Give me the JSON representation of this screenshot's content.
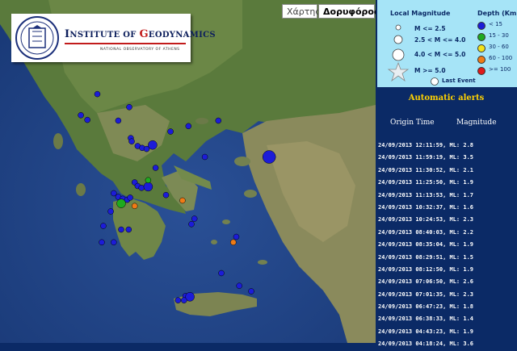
{
  "map": {
    "buttons": {
      "map_label": "Χάρτης",
      "satellite_label": "Δορυφόρος"
    },
    "logo": {
      "name_prefix": "I",
      "name_part1": "NSTITUTE OF ",
      "name_accent": "G",
      "name_part2": "EODYNAMICS",
      "subtitle": "NATIONAL OBSERVATORY OF ATHENS"
    },
    "events": [
      {
        "lon": 21.85,
        "lat": 40.63,
        "size": "small",
        "depth": "<15"
      },
      {
        "lon": 21.3,
        "lat": 40.05,
        "size": "small",
        "depth": "<15"
      },
      {
        "lon": 21.52,
        "lat": 39.92,
        "size": "small",
        "depth": "<15"
      },
      {
        "lon": 22.92,
        "lat": 40.27,
        "size": "small",
        "depth": "<15"
      },
      {
        "lon": 22.55,
        "lat": 39.9,
        "size": "small",
        "depth": "<15"
      },
      {
        "lon": 22.97,
        "lat": 39.42,
        "size": "small",
        "depth": "<15"
      },
      {
        "lon": 23.2,
        "lat": 39.2,
        "size": "small",
        "depth": "<15"
      },
      {
        "lon": 23.35,
        "lat": 39.15,
        "size": "small",
        "depth": "<15"
      },
      {
        "lon": 23.5,
        "lat": 39.12,
        "size": "small",
        "depth": "<15"
      },
      {
        "lon": 23.7,
        "lat": 39.23,
        "size": "medium",
        "depth": "<15"
      },
      {
        "lon": 23.0,
        "lat": 39.33,
        "size": "small",
        "depth": "<15"
      },
      {
        "lon": 24.3,
        "lat": 39.6,
        "size": "small",
        "depth": "<15"
      },
      {
        "lon": 24.9,
        "lat": 39.75,
        "size": "small",
        "depth": "<15"
      },
      {
        "lon": 25.9,
        "lat": 39.9,
        "size": "small",
        "depth": "<15"
      },
      {
        "lon": 27.6,
        "lat": 38.9,
        "size": "large",
        "depth": "<15"
      },
      {
        "lon": 25.45,
        "lat": 38.9,
        "size": "small",
        "depth": "<15"
      },
      {
        "lon": 23.1,
        "lat": 38.2,
        "size": "small",
        "depth": "<15"
      },
      {
        "lon": 23.2,
        "lat": 38.1,
        "size": "small",
        "depth": "<15"
      },
      {
        "lon": 23.33,
        "lat": 38.05,
        "size": "small",
        "depth": "<15"
      },
      {
        "lon": 23.55,
        "lat": 38.08,
        "size": "medium",
        "depth": "<15"
      },
      {
        "lon": 23.55,
        "lat": 38.26,
        "size": "small",
        "depth": "15-30"
      },
      {
        "lon": 22.4,
        "lat": 37.9,
        "size": "small",
        "depth": "<15"
      },
      {
        "lon": 22.55,
        "lat": 37.8,
        "size": "small",
        "depth": "<15"
      },
      {
        "lon": 22.7,
        "lat": 37.75,
        "size": "small",
        "depth": "<15"
      },
      {
        "lon": 22.85,
        "lat": 37.72,
        "size": "small",
        "depth": "<15"
      },
      {
        "lon": 22.95,
        "lat": 37.78,
        "size": "small",
        "depth": "<15"
      },
      {
        "lon": 22.65,
        "lat": 37.62,
        "size": "medium",
        "depth": "15-30"
      },
      {
        "lon": 23.1,
        "lat": 37.55,
        "size": "small",
        "depth": "60-100"
      },
      {
        "lon": 22.3,
        "lat": 37.4,
        "size": "small",
        "depth": "<15"
      },
      {
        "lon": 22.05,
        "lat": 37.0,
        "size": "small",
        "depth": "<15"
      },
      {
        "lon": 22.65,
        "lat": 36.9,
        "size": "small",
        "depth": "<15"
      },
      {
        "lon": 22.9,
        "lat": 36.9,
        "size": "small",
        "depth": "<15"
      },
      {
        "lon": 22.0,
        "lat": 36.55,
        "size": "small",
        "depth": "<15"
      },
      {
        "lon": 22.4,
        "lat": 36.55,
        "size": "small",
        "depth": "<15"
      },
      {
        "lon": 24.7,
        "lat": 37.7,
        "size": "small",
        "depth": "60-100"
      },
      {
        "lon": 25.0,
        "lat": 37.05,
        "size": "small",
        "depth": "<15"
      },
      {
        "lon": 25.1,
        "lat": 37.2,
        "size": "small",
        "depth": "<15"
      },
      {
        "lon": 26.4,
        "lat": 36.55,
        "size": "small",
        "depth": "60-100"
      },
      {
        "lon": 26.5,
        "lat": 36.7,
        "size": "small",
        "depth": "<15"
      },
      {
        "lon": 26.0,
        "lat": 35.7,
        "size": "small",
        "depth": "<15"
      },
      {
        "lon": 26.6,
        "lat": 35.35,
        "size": "small",
        "depth": "<15"
      },
      {
        "lon": 24.8,
        "lat": 35.07,
        "size": "small",
        "depth": "<15"
      },
      {
        "lon": 24.95,
        "lat": 35.05,
        "size": "medium",
        "depth": "<15"
      },
      {
        "lon": 24.75,
        "lat": 34.95,
        "size": "small",
        "depth": "<15"
      },
      {
        "lon": 24.55,
        "lat": 34.95,
        "size": "small",
        "depth": "<15"
      },
      {
        "lon": 27.0,
        "lat": 35.2,
        "size": "small",
        "depth": "<15"
      },
      {
        "lon": 24.15,
        "lat": 37.85,
        "size": "small",
        "depth": "<15"
      },
      {
        "lon": 23.8,
        "lat": 38.6,
        "size": "small",
        "depth": "<15"
      }
    ]
  },
  "legend": {
    "magnitude_title": "Local Magnitude",
    "depth_title": "Depth (Km)",
    "magnitude_items": [
      "M <= 2.5",
      "2.5 < M <= 4.0",
      "4.0 < M <= 5.0",
      "M >= 5.0"
    ],
    "last_event_label": "Last Event",
    "depth_items": [
      {
        "label": "< 15",
        "color": "#1c1cd8"
      },
      {
        "label": "15 - 30",
        "color": "#1faa1f"
      },
      {
        "label": "30 - 60",
        "color": "#f2e21a"
      },
      {
        "label": "60 - 100",
        "color": "#f07b16"
      },
      {
        "label": ">= 100",
        "color": "#e01a1a"
      }
    ]
  },
  "alerts": {
    "title": "Automatic alerts",
    "col_origin": "Origin Time",
    "col_magnitude": "Magnitude",
    "rows": [
      "24/09/2013 12:11:59, ML: 2.8",
      "24/09/2013 11:59:19, ML: 3.5",
      "24/09/2013 11:30:52, ML: 2.1",
      "24/09/2013 11:25:50, ML: 1.9",
      "24/09/2013 11:13:53, ML: 1.7",
      "24/09/2013 10:32:37, ML: 1.6",
      "24/09/2013 10:24:53, ML: 2.3",
      "24/09/2013 08:40:03, ML: 2.2",
      "24/09/2013 08:35:04, ML: 1.9",
      "24/09/2013 08:29:51, ML: 1.5",
      "24/09/2013 08:12:50, ML: 1.9",
      "24/09/2013 07:06:50, ML: 2.6",
      "24/09/2013 07:01:35, ML: 2.3",
      "24/09/2013 06:47:23, ML: 1.8",
      "24/09/2013 06:38:33, ML: 1.4",
      "24/09/2013 04:43:23, ML: 1.9",
      "24/09/2013 04:18:24, ML: 3.6"
    ]
  }
}
